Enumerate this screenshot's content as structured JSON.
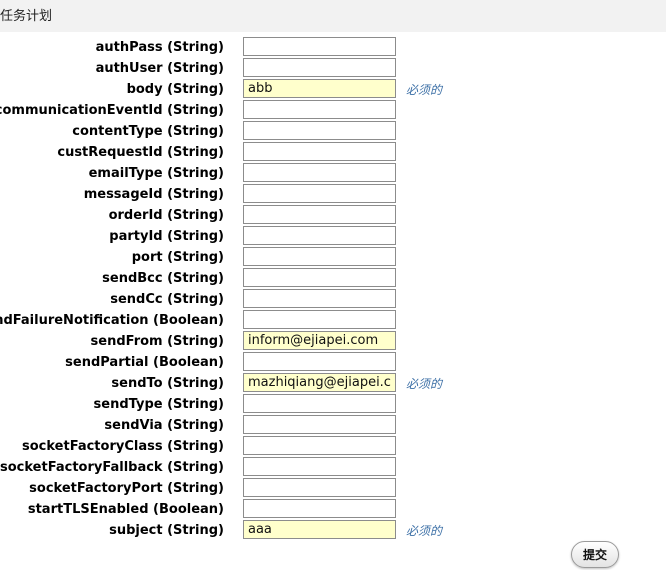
{
  "header": {
    "title": "任务计划"
  },
  "form": {
    "required_text": "必须的",
    "fields": [
      {
        "label": "authPass (String)",
        "value": "",
        "required": false
      },
      {
        "label": "authUser (String)",
        "value": "",
        "required": false
      },
      {
        "label": "body (String)",
        "value": "abb",
        "required": true
      },
      {
        "label": "communicationEventId (String)",
        "value": "",
        "required": false
      },
      {
        "label": "contentType (String)",
        "value": "",
        "required": false
      },
      {
        "label": "custRequestId (String)",
        "value": "",
        "required": false
      },
      {
        "label": "emailType (String)",
        "value": "",
        "required": false
      },
      {
        "label": "messageId (String)",
        "value": "",
        "required": false
      },
      {
        "label": "orderId (String)",
        "value": "",
        "required": false
      },
      {
        "label": "partyId (String)",
        "value": "",
        "required": false
      },
      {
        "label": "port (String)",
        "value": "",
        "required": false
      },
      {
        "label": "sendBcc (String)",
        "value": "",
        "required": false
      },
      {
        "label": "sendCc (String)",
        "value": "",
        "required": false
      },
      {
        "label": "sendFailureNotification (Boolean)",
        "value": "",
        "required": false
      },
      {
        "label": "sendFrom (String)",
        "value": "inform@ejiapei.com",
        "required": false
      },
      {
        "label": "sendPartial (Boolean)",
        "value": "",
        "required": false
      },
      {
        "label": "sendTo (String)",
        "value": "mazhiqiang@ejiapei.com",
        "required": true
      },
      {
        "label": "sendType (String)",
        "value": "",
        "required": false
      },
      {
        "label": "sendVia (String)",
        "value": "",
        "required": false
      },
      {
        "label": "socketFactoryClass (String)",
        "value": "",
        "required": false
      },
      {
        "label": "socketFactoryFallback (String)",
        "value": "",
        "required": false
      },
      {
        "label": "socketFactoryPort (String)",
        "value": "",
        "required": false
      },
      {
        "label": "startTLSEnabled (Boolean)",
        "value": "",
        "required": false
      },
      {
        "label": "subject (String)",
        "value": "aaa",
        "required": true
      }
    ],
    "submit_label": "提交"
  }
}
